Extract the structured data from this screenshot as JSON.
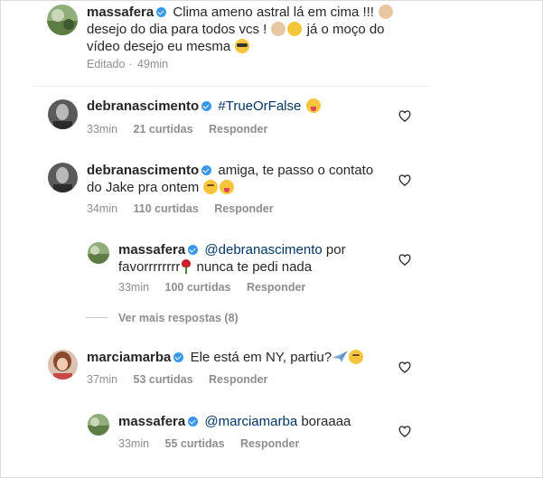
{
  "post": {
    "username": "massafera",
    "caption_line1": "Clima ameno astral lá em cima !!!",
    "caption_line2a": "desejo do dia para todos vcs !",
    "caption_line2b": "já o moço do",
    "caption_line3": "vídeo desejo eu mesma",
    "edited": "Editado",
    "time": "49min"
  },
  "comments": [
    {
      "username": "debranascimento",
      "text": "#TrueOrFalse",
      "time": "33min",
      "likes": "21 curtidas",
      "reply": "Responder"
    },
    {
      "username": "debranascimento",
      "text_line1": "amiga, te passo o contato",
      "text_line2": "do Jake pra ontem",
      "time": "34min",
      "likes": "110 curtidas",
      "reply": "Responder"
    },
    {
      "username": "massafera",
      "mention": "@debranascimento",
      "text_line1": "por",
      "text_line2a": "favorrrrrrrr",
      "text_line2b": "nunca te pedi nada",
      "time": "33min",
      "likes": "100 curtidas",
      "reply": "Responder"
    },
    {
      "username": "marciamarba",
      "text": "Ele está em NY, partiu?",
      "time": "37min",
      "likes": "53 curtidas",
      "reply": "Responder"
    },
    {
      "username": "massafera",
      "mention": "@marciamarba",
      "text": "boraaaa",
      "time": "33min",
      "likes": "55 curtidas",
      "reply": "Responder"
    }
  ],
  "view_more": "Ver mais respostas (8)",
  "icons": {
    "like": "heart-outline-icon",
    "verified": "verified-badge-icon"
  },
  "colors": {
    "verified": "#3897f0",
    "meta_text": "#8e8e8e",
    "hashtag": "#003569"
  }
}
